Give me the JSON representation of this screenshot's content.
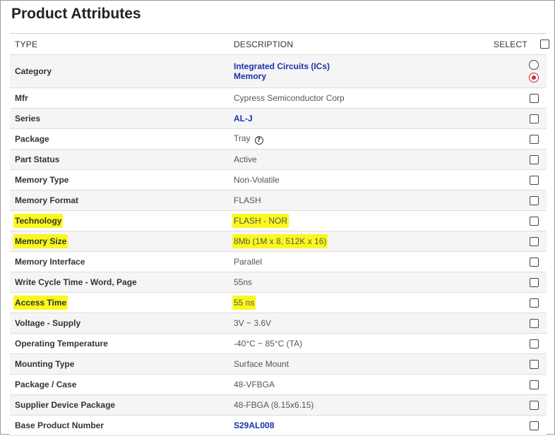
{
  "page": {
    "title": "Product Attributes"
  },
  "table": {
    "headers": {
      "type": "TYPE",
      "description": "DESCRIPTION",
      "select": "SELECT"
    },
    "category": {
      "label": "Category",
      "values": [
        "Integrated Circuits (ICs)",
        "Memory"
      ],
      "radio_selected": 1
    },
    "rows": [
      {
        "type": "Mfr",
        "description": "Cypress Semiconductor Corp",
        "link": false,
        "highlight": false
      },
      {
        "type": "Series",
        "description": "AL-J",
        "link": true,
        "highlight": false
      },
      {
        "type": "Package",
        "description": "Tray",
        "link": false,
        "highlight": false,
        "help_icon": "question-circle-icon",
        "help_glyph": "?"
      },
      {
        "type": "Part Status",
        "description": "Active",
        "link": false,
        "highlight": false
      },
      {
        "type": "Memory Type",
        "description": "Non-Volatile",
        "link": false,
        "highlight": false
      },
      {
        "type": "Memory Format",
        "description": "FLASH",
        "link": false,
        "highlight": false
      },
      {
        "type": "Technology",
        "description": "FLASH - NOR",
        "link": false,
        "highlight": true
      },
      {
        "type": "Memory Size",
        "description": "8Mb (1M x 8, 512K x 16)",
        "link": false,
        "highlight": true
      },
      {
        "type": "Memory Interface",
        "description": "Parallel",
        "link": false,
        "highlight": false
      },
      {
        "type": "Write Cycle Time - Word, Page",
        "description": "55ns",
        "link": false,
        "highlight": false
      },
      {
        "type": "Access Time",
        "description": "55 ns",
        "link": false,
        "highlight": true
      },
      {
        "type": "Voltage - Supply",
        "description": "3V ~ 3.6V",
        "link": false,
        "highlight": false
      },
      {
        "type": "Operating Temperature",
        "description": "-40°C ~ 85°C (TA)",
        "link": false,
        "highlight": false
      },
      {
        "type": "Mounting Type",
        "description": "Surface Mount",
        "link": false,
        "highlight": false
      },
      {
        "type": "Package / Case",
        "description": "48-VFBGA",
        "link": false,
        "highlight": false
      },
      {
        "type": "Supplier Device Package",
        "description": "48-FBGA (8.15x6.15)",
        "link": false,
        "highlight": false
      },
      {
        "type": "Base Product Number",
        "description": "S29AL008",
        "link": true,
        "highlight": false
      }
    ]
  },
  "colors": {
    "link": "#1a32a6",
    "highlight": "#f9f91e",
    "radio_selected": "#d32f2f"
  }
}
